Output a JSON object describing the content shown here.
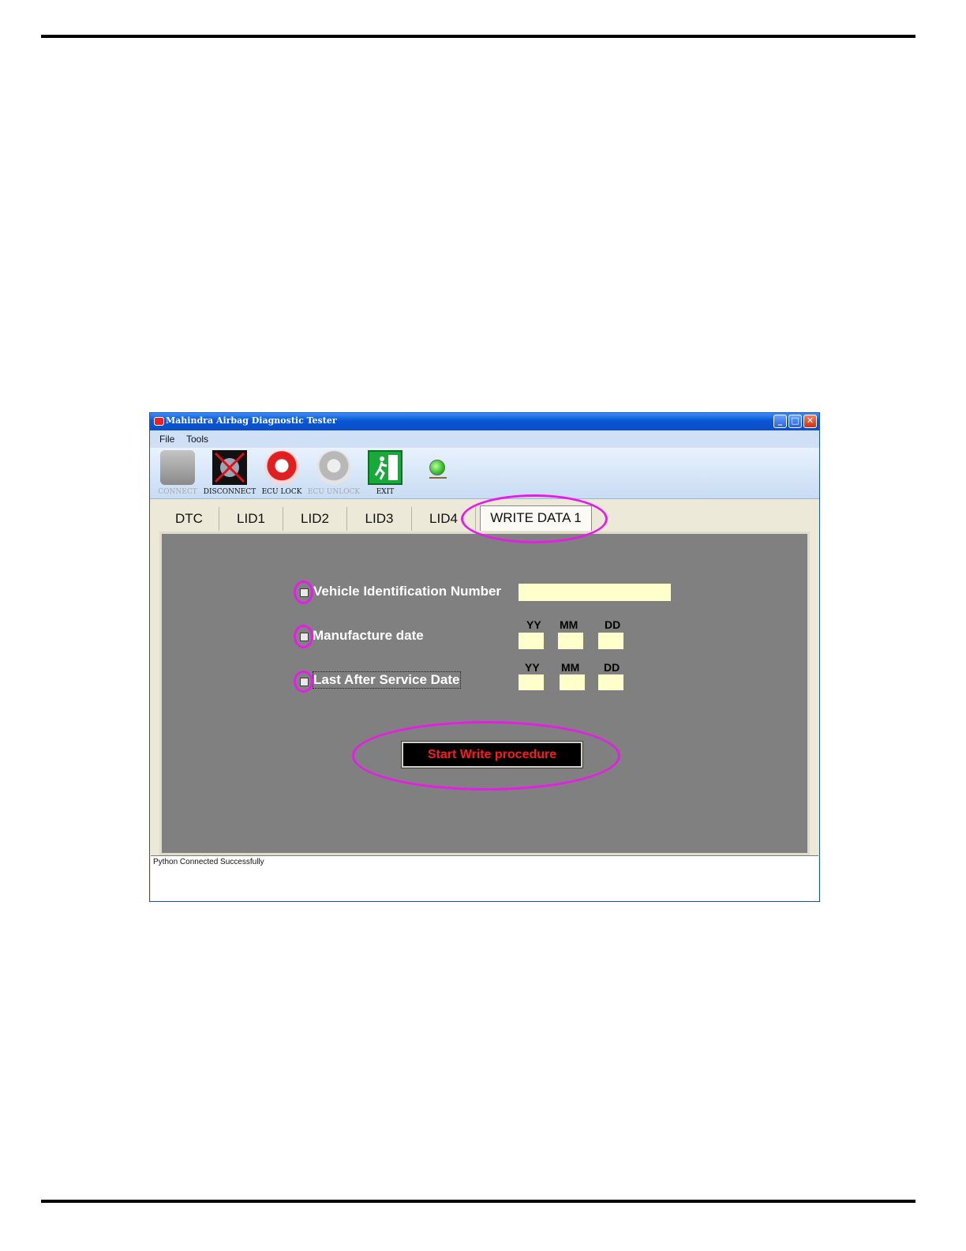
{
  "window": {
    "title": "Mahindra Airbag Diagnostic Tester",
    "controls": {
      "minimize": "_",
      "maximize": "□",
      "close": "✕"
    }
  },
  "menu": {
    "file": "File",
    "tools": "Tools"
  },
  "toolbar": {
    "connect": "CONNECT",
    "disconnect": "DISCONNECT",
    "ecu_lock": "ECU LOCK",
    "ecu_unlock": "ECU UNLOCK",
    "exit": "EXIT",
    "status_led_color": "#2fbf28"
  },
  "tabs": [
    {
      "label": "DTC"
    },
    {
      "label": "LID1"
    },
    {
      "label": "LID2"
    },
    {
      "label": "LID3"
    },
    {
      "label": "LID4"
    },
    {
      "label": "WRITE DATA 1",
      "active": true
    }
  ],
  "form": {
    "vin_label": "Vehicle Identification Number",
    "vin_value": "",
    "manufacture_label": "Manufacture date",
    "service_label": "Last After Service Date",
    "date_columns": [
      "YY",
      "MM",
      "DD"
    ]
  },
  "start_button": "Start Write procedure",
  "status": {
    "message": "Python Connected Successfully"
  },
  "colors": {
    "annotation": "#e81ce8",
    "panel": "#808080",
    "field": "#ffffcc",
    "button_text": "#ff1a1a"
  }
}
